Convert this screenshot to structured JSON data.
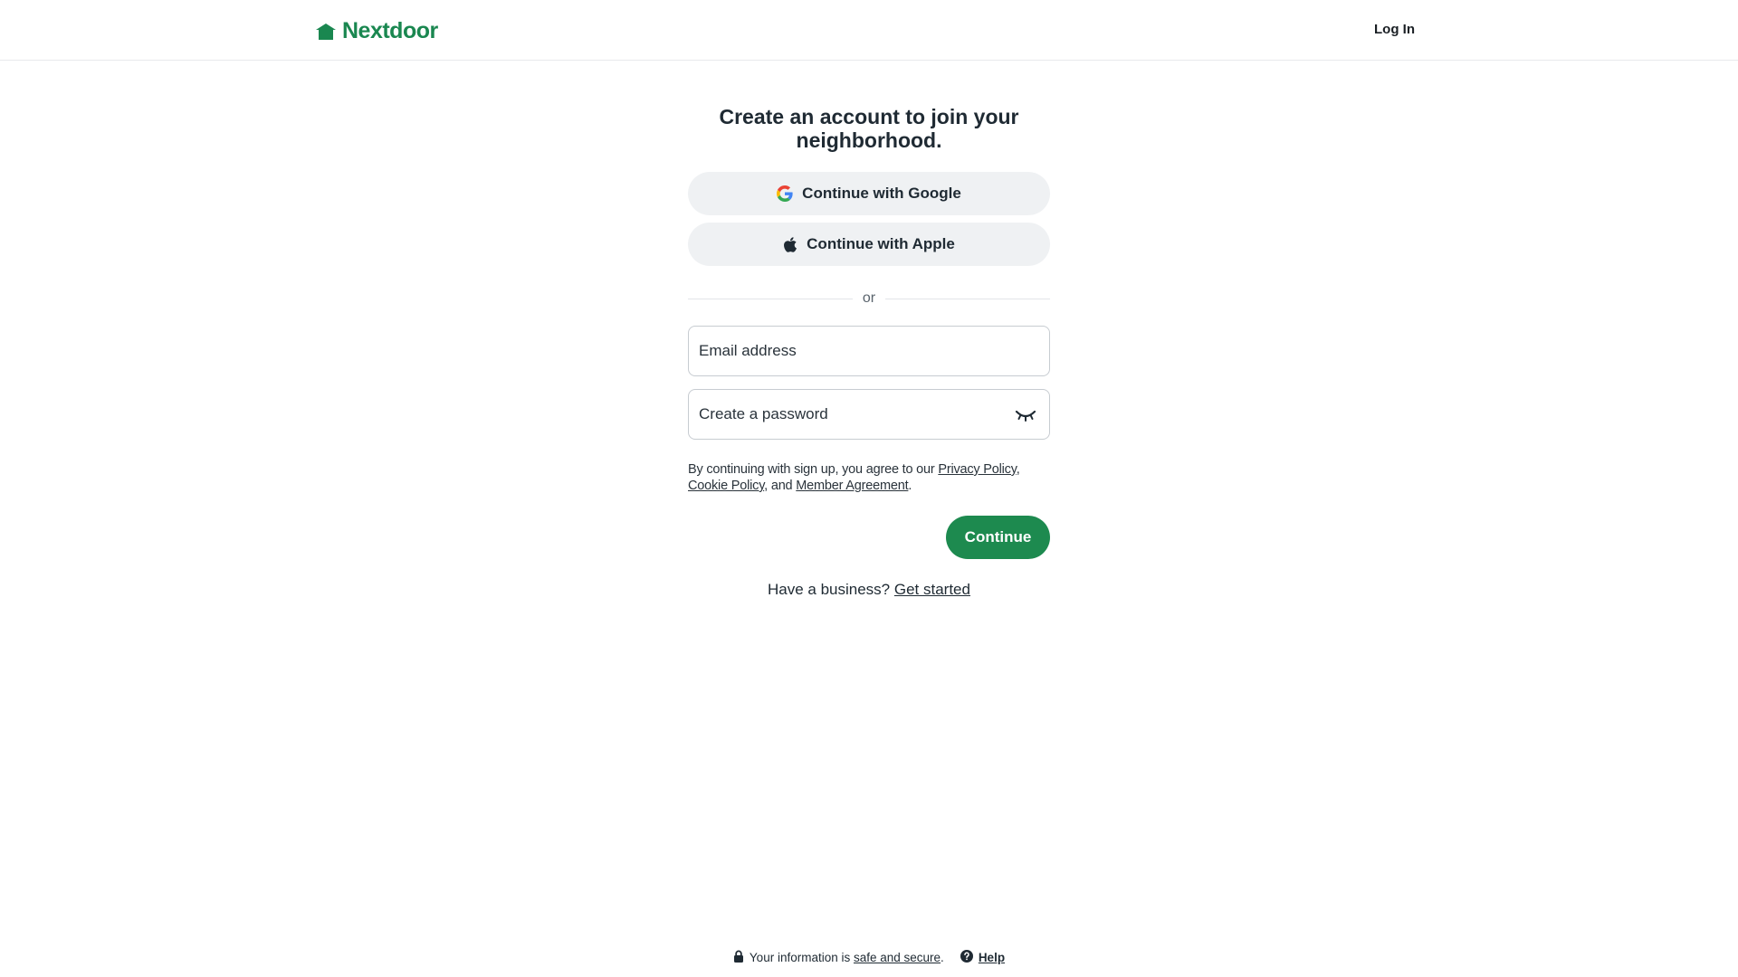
{
  "header": {
    "brand_name": "Nextdoor",
    "login_label": "Log In"
  },
  "main": {
    "title": "Create an account to join your neighborhood.",
    "google_button_label": "Continue with Google",
    "apple_button_label": "Continue with Apple",
    "divider_label": "or",
    "email_placeholder": "Email address",
    "email_value": "",
    "password_placeholder": "Create a password",
    "password_value": "",
    "legal": {
      "prefix": "By continuing with sign up, you agree to our ",
      "privacy_link": "Privacy Policy",
      "sep1": ", ",
      "cookie_link": "Cookie Policy",
      "sep2": ", and ",
      "member_link": "Member Agreement",
      "suffix": "."
    },
    "continue_label": "Continue",
    "business_prompt": "Have a business? ",
    "business_link": "Get started"
  },
  "footer": {
    "secure_prefix": "Your information is ",
    "secure_link": "safe and secure",
    "secure_suffix": ".",
    "help_label": "Help"
  },
  "colors": {
    "brand_green": "#1d8a4f",
    "sso_button_bg": "#eff1f3"
  },
  "icons": {
    "logo": "house-icon",
    "google": "google-icon",
    "apple": "apple-icon",
    "password_toggle": "eye-closed-icon",
    "lock": "lock-icon",
    "help": "question-circle-icon"
  }
}
